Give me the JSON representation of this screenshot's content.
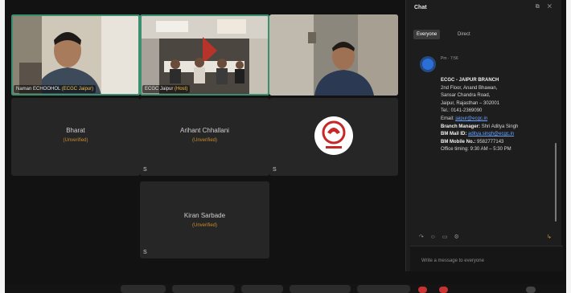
{
  "participants": [
    {
      "id": "p1",
      "label": "Naman ECHOOHOL",
      "tag": "(ECGC Jaipur)"
    },
    {
      "id": "p2",
      "label": "ECGC Jaipur",
      "tag": "(Host)"
    },
    {
      "id": "p3",
      "label": ""
    },
    {
      "id": "bharat",
      "name": "Bharat",
      "status": "(Unverified)"
    },
    {
      "id": "arihant",
      "name": "Arihant Chhallani",
      "status": "(Unverified)"
    },
    {
      "id": "logo",
      "name": ""
    },
    {
      "id": "kiran",
      "name": "Kiran Sarbade",
      "status": "(Unverified)"
    }
  ],
  "tile_footer": "S",
  "chat": {
    "title": "Chat",
    "controls": "⧉ ✕",
    "tabs": [
      "Everyone",
      "Direct"
    ],
    "meta": "Pm · 7:56",
    "message": {
      "heading": "ECGC - JAIPUR BRANCH",
      "address": [
        "2nd Floor, Anand Bhawan,",
        "Sansar Chandra Road,",
        "Jaipur, Rajasthan – 302001"
      ],
      "tel": "Tel.: 0141-2369090",
      "email_label": "Email:",
      "email": "jaipur@ecgc.in",
      "manager_label": "Branch Manager:",
      "manager": "Shri Aditya Singh",
      "bm_mail_label": "BM Mail ID:",
      "bm_mail": "aditya.singh@ecgc.in",
      "bm_mobile_label": "BM Mobile No.:",
      "bm_mobile": "9582777143",
      "timing": "Office timing: 9:30 AM – 5:30 PM"
    },
    "tool_icons": "↷ ☺ ▭ ⚙",
    "send_icon": "↳",
    "input_placeholder": "Write a message to everyone"
  },
  "colors": {
    "selected_border": "#3a8f6e",
    "unverified": "#c98a2c",
    "link": "#6aa4ff",
    "leave": "#c83232"
  }
}
